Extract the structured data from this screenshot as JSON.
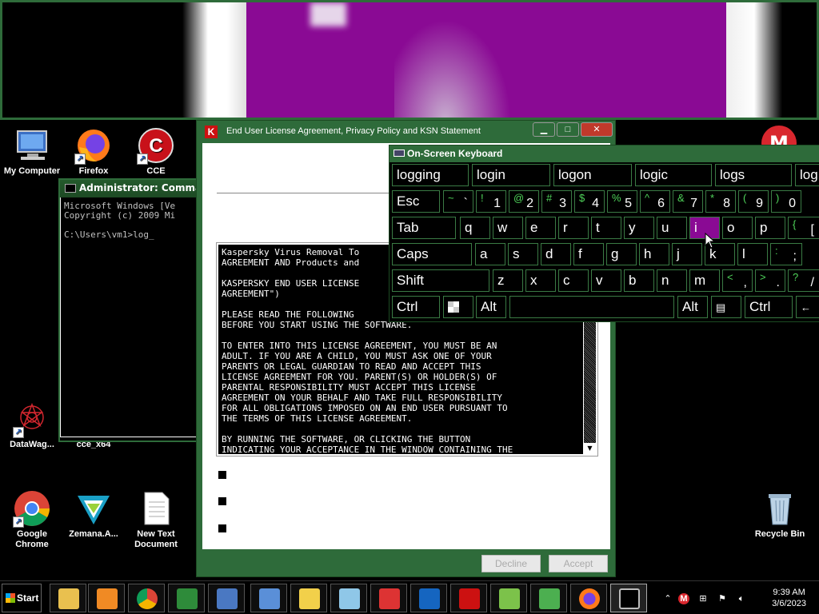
{
  "desktop": {
    "icons": [
      {
        "label": "My Computer",
        "icon": "computer-icon"
      },
      {
        "label": "Firefox",
        "icon": "firefox-icon"
      },
      {
        "label": "CCE",
        "icon": "cce-icon"
      },
      {
        "label": "DataWag...",
        "icon": "datawag-icon"
      },
      {
        "label": "cce_x64",
        "icon": "folder-icon"
      },
      {
        "label": "Google Chrome",
        "icon": "chrome-icon"
      },
      {
        "label": "Zemana.A...",
        "icon": "zemana-icon"
      },
      {
        "label": "New Text Document",
        "icon": "text-document-icon"
      },
      {
        "label": "Recycle Bin",
        "icon": "recycle-bin-icon"
      }
    ]
  },
  "cmd": {
    "title": "Administrator: Command P",
    "lines": "Microsoft Windows [Ve\nCopyright (c) 2009 Mi\n\nC:\\Users\\vm1>log_"
  },
  "license_dialog": {
    "title": "End User License Agreement, Privacy Policy and KSN Statement",
    "text": "Kaspersky Virus Removal To\nAGREEMENT AND Products and\n\nKASPERSKY END USER LICENSE\nAGREEMENT\")\n\nPLEASE READ THE FOLLOWING\nBEFORE YOU START USING THE SOFTWARE.\n\nTO ENTER INTO THIS LICENSE AGREEMENT, YOU MUST BE AN\nADULT. IF YOU ARE A CHILD, YOU MUST ASK ONE OF YOUR\nPARENTS OR LEGAL GUARDIAN TO READ AND ACCEPT THIS\nLICENSE AGREEMENT FOR YOU. PARENT(S) OR HOLDER(S) OF\nPARENTAL RESPONSIBILITY MUST ACCEPT THIS LICENSE\nAGREEMENT ON YOUR BEHALF AND TAKE FULL RESPONSIBILITY\nFOR ALL OBLIGATIONS IMPOSED ON AN END USER PURSUANT TO\nTHE TERMS OF THIS LICENSE AGREEMENT.\n\nBY RUNNING THE SOFTWARE, OR CLICKING THE BUTTON\nINDICATING YOUR ACCEPTANCE IN THE WINDOW CONTAINING THE",
    "decline_label": "Decline",
    "accept_label": "Accept"
  },
  "osk": {
    "title": "On-Screen Keyboard",
    "predictions": [
      "logging",
      "login",
      "logon",
      "logic",
      "logs",
      "log"
    ],
    "row1": [
      {
        "sh": "~",
        "mn": "`"
      },
      {
        "sh": "!",
        "mn": "1"
      },
      {
        "sh": "@",
        "mn": "2"
      },
      {
        "sh": "#",
        "mn": "3"
      },
      {
        "sh": "$",
        "mn": "4"
      },
      {
        "sh": "%",
        "mn": "5"
      },
      {
        "sh": "^",
        "mn": "6"
      },
      {
        "sh": "&",
        "mn": "7"
      },
      {
        "sh": "*",
        "mn": "8"
      },
      {
        "sh": "(",
        "mn": "9"
      },
      {
        "sh": ")",
        "mn": "0"
      }
    ],
    "keys": {
      "esc": "Esc",
      "tab": "Tab",
      "caps": "Caps",
      "shift": "Shift",
      "ctrl": "Ctrl",
      "alt": "Alt",
      "alt_r": "Alt",
      "ctrl_r": "Ctrl",
      "q": "q",
      "w": "w",
      "e": "e",
      "r": "r",
      "t": "t",
      "y": "y",
      "u": "u",
      "i": "i",
      "o": "o",
      "p": "p",
      "a": "a",
      "s": "s",
      "d": "d",
      "f": "f",
      "g": "g",
      "h": "h",
      "j": "j",
      "k": "k",
      "l": "l",
      "z": "z",
      "x": "x",
      "c": "c",
      "v": "v",
      "b": "b",
      "n": "n",
      "m": "m"
    },
    "punct": [
      {
        "sh": "{",
        "mn": "["
      },
      {
        "sh": ":",
        "mn": ";"
      },
      {
        "sh": "<",
        "mn": ","
      },
      {
        "sh": ">",
        "mn": "."
      },
      {
        "sh": "?",
        "mn": "/"
      }
    ],
    "highlighted_key": "i",
    "highlight_color": "#8a0a94"
  },
  "taskbar": {
    "start_label": "Start",
    "time": "9:39 AM",
    "date": "3/6/2023"
  }
}
